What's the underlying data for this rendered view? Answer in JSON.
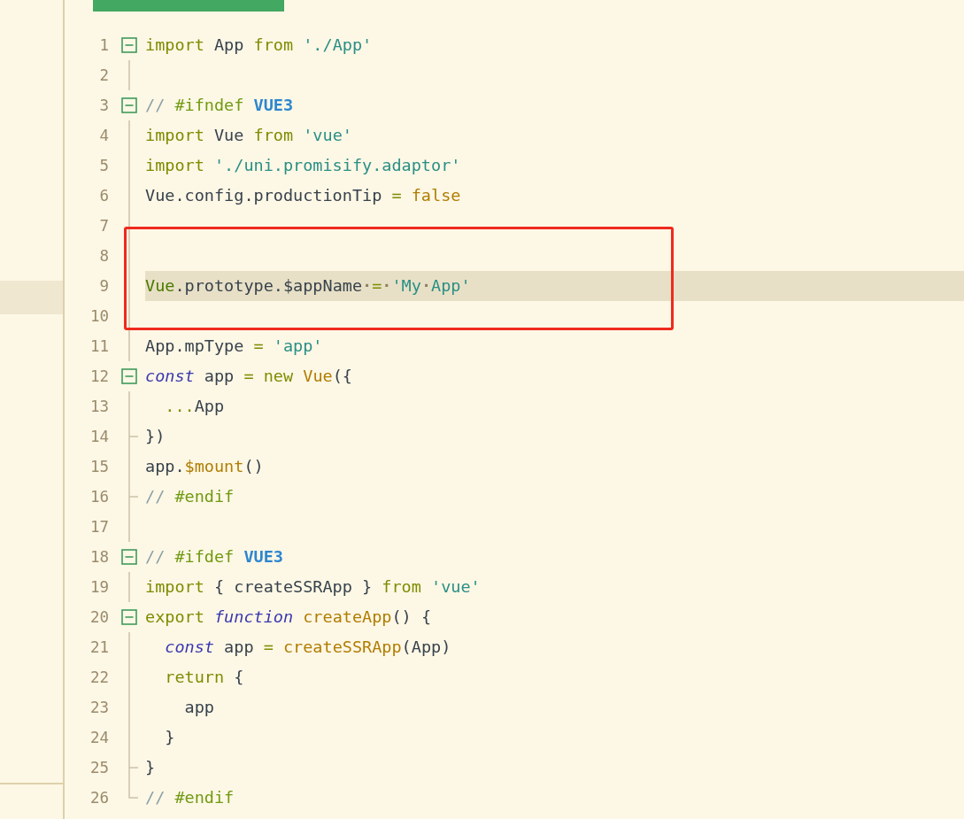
{
  "tabs": [
    {
      "selected": true
    },
    {
      "selected": false
    }
  ],
  "editor": {
    "lines": [
      {
        "number": "1",
        "gutter": {
          "kind": "fold"
        },
        "current": false,
        "tokens": [
          {
            "kind": "keyword",
            "text": "import"
          },
          {
            "kind": "plain",
            "text": " App"
          },
          {
            "kind": "keyword",
            "text": " from"
          },
          {
            "kind": "string",
            "text": " './App'"
          }
        ]
      },
      {
        "number": "2",
        "gutter": {
          "kind": "guide"
        },
        "current": false
      },
      {
        "number": "3",
        "gutter": {
          "kind": "fold"
        },
        "current": false,
        "tokens": [
          {
            "kind": "comment",
            "text": "//"
          },
          {
            "kind": "directive",
            "text": " #ifndef"
          },
          {
            "kind": "macro",
            "text": " VUE3"
          }
        ]
      },
      {
        "number": "4",
        "gutter": {
          "kind": "guide"
        },
        "current": false,
        "tokens": [
          {
            "kind": "keyword",
            "text": "import"
          },
          {
            "kind": "plain",
            "text": " Vue"
          },
          {
            "kind": "keyword",
            "text": " from"
          },
          {
            "kind": "string",
            "text": " 'vue'"
          }
        ]
      },
      {
        "number": "5",
        "gutter": {
          "kind": "guide"
        },
        "current": false,
        "tokens": [
          {
            "kind": "keyword",
            "text": "import"
          },
          {
            "kind": "string",
            "text": " './uni.promisify.adaptor'"
          }
        ]
      },
      {
        "number": "6",
        "gutter": {
          "kind": "guide"
        },
        "current": false,
        "tokens": [
          {
            "kind": "plain",
            "text": "Vue.config.productionTip"
          },
          {
            "kind": "keyword",
            "text": " ="
          },
          {
            "kind": "call",
            "text": " false"
          }
        ]
      },
      {
        "number": "7",
        "gutter": {
          "kind": "guide"
        },
        "current": false
      },
      {
        "number": "8",
        "gutter": {
          "kind": "guide"
        },
        "current": false
      },
      {
        "number": "9",
        "gutter": {
          "kind": "guide"
        },
        "current": true,
        "tokens": [
          {
            "kind": "class",
            "text": "Vue"
          },
          {
            "kind": "plain",
            "text": ".prototype.$appName"
          },
          {
            "kind": "space",
            "text": "·"
          },
          {
            "kind": "keyword",
            "text": "="
          },
          {
            "kind": "space",
            "text": "·"
          },
          {
            "kind": "string",
            "text": "'My"
          },
          {
            "kind": "space",
            "text": "·"
          },
          {
            "kind": "string",
            "text": "App'"
          }
        ]
      },
      {
        "number": "10",
        "gutter": {
          "kind": "guide"
        },
        "current": false
      },
      {
        "number": "11",
        "gutter": {
          "kind": "guide"
        },
        "current": false,
        "tokens": [
          {
            "kind": "plain",
            "text": "App.mpType"
          },
          {
            "kind": "keyword",
            "text": " ="
          },
          {
            "kind": "string",
            "text": " 'app'"
          }
        ]
      },
      {
        "number": "12",
        "gutter": {
          "kind": "fold"
        },
        "current": false,
        "tokens": [
          {
            "kind": "storage",
            "text": "const"
          },
          {
            "kind": "plain",
            "text": " app"
          },
          {
            "kind": "keyword",
            "text": " ="
          },
          {
            "kind": "keyword",
            "text": " new"
          },
          {
            "kind": "call",
            "text": " Vue"
          },
          {
            "kind": "plain",
            "text": "({"
          }
        ]
      },
      {
        "number": "13",
        "gutter": {
          "kind": "guide"
        },
        "current": false,
        "tokens": [
          {
            "kind": "keyword",
            "text": "  ..."
          },
          {
            "kind": "plain",
            "text": "App"
          }
        ]
      },
      {
        "number": "14",
        "gutter": {
          "kind": "branch"
        },
        "current": false,
        "tokens": [
          {
            "kind": "plain",
            "text": "})"
          }
        ]
      },
      {
        "number": "15",
        "gutter": {
          "kind": "guide"
        },
        "current": false,
        "tokens": [
          {
            "kind": "plain",
            "text": "app."
          },
          {
            "kind": "call",
            "text": "$mount"
          },
          {
            "kind": "plain",
            "text": "()"
          }
        ]
      },
      {
        "number": "16",
        "gutter": {
          "kind": "branch"
        },
        "current": false,
        "tokens": [
          {
            "kind": "comment",
            "text": "//"
          },
          {
            "kind": "directive",
            "text": " #endif"
          }
        ]
      },
      {
        "number": "17",
        "gutter": {
          "kind": "guide"
        },
        "current": false
      },
      {
        "number": "18",
        "gutter": {
          "kind": "fold"
        },
        "current": false,
        "tokens": [
          {
            "kind": "comment",
            "text": "//"
          },
          {
            "kind": "directive",
            "text": " #ifdef"
          },
          {
            "kind": "macro",
            "text": " VUE3"
          }
        ]
      },
      {
        "number": "19",
        "gutter": {
          "kind": "guide"
        },
        "current": false,
        "tokens": [
          {
            "kind": "keyword",
            "text": "import"
          },
          {
            "kind": "plain",
            "text": " { createSSRApp }"
          },
          {
            "kind": "keyword",
            "text": " from"
          },
          {
            "kind": "string",
            "text": " 'vue'"
          }
        ]
      },
      {
        "number": "20",
        "gutter": {
          "kind": "fold"
        },
        "current": false,
        "tokens": [
          {
            "kind": "keyword",
            "text": "export"
          },
          {
            "kind": "storage",
            "text": " function"
          },
          {
            "kind": "call",
            "text": " createApp"
          },
          {
            "kind": "plain",
            "text": "() {"
          }
        ]
      },
      {
        "number": "21",
        "gutter": {
          "kind": "guide"
        },
        "current": false,
        "tokens": [
          {
            "kind": "storage",
            "text": "  const"
          },
          {
            "kind": "plain",
            "text": " app"
          },
          {
            "kind": "keyword",
            "text": " ="
          },
          {
            "kind": "call",
            "text": " createSSRApp"
          },
          {
            "kind": "plain",
            "text": "(App)"
          }
        ]
      },
      {
        "number": "22",
        "gutter": {
          "kind": "guide"
        },
        "current": false,
        "tokens": [
          {
            "kind": "keyword",
            "text": "  return"
          },
          {
            "kind": "plain",
            "text": " {"
          }
        ]
      },
      {
        "number": "23",
        "gutter": {
          "kind": "guide"
        },
        "current": false,
        "tokens": [
          {
            "kind": "plain",
            "text": "    app"
          }
        ]
      },
      {
        "number": "24",
        "gutter": {
          "kind": "guide"
        },
        "current": false,
        "tokens": [
          {
            "kind": "plain",
            "text": "  }"
          }
        ]
      },
      {
        "number": "25",
        "gutter": {
          "kind": "branch"
        },
        "current": false,
        "tokens": [
          {
            "kind": "plain",
            "text": "}"
          }
        ]
      },
      {
        "number": "26",
        "gutter": {
          "kind": "end"
        },
        "current": false,
        "tokens": [
          {
            "kind": "comment",
            "text": "//"
          },
          {
            "kind": "directive",
            "text": " #endif"
          }
        ]
      }
    ]
  },
  "annotations": [
    {
      "kind": "box",
      "color": "#ee2a1e"
    }
  ]
}
